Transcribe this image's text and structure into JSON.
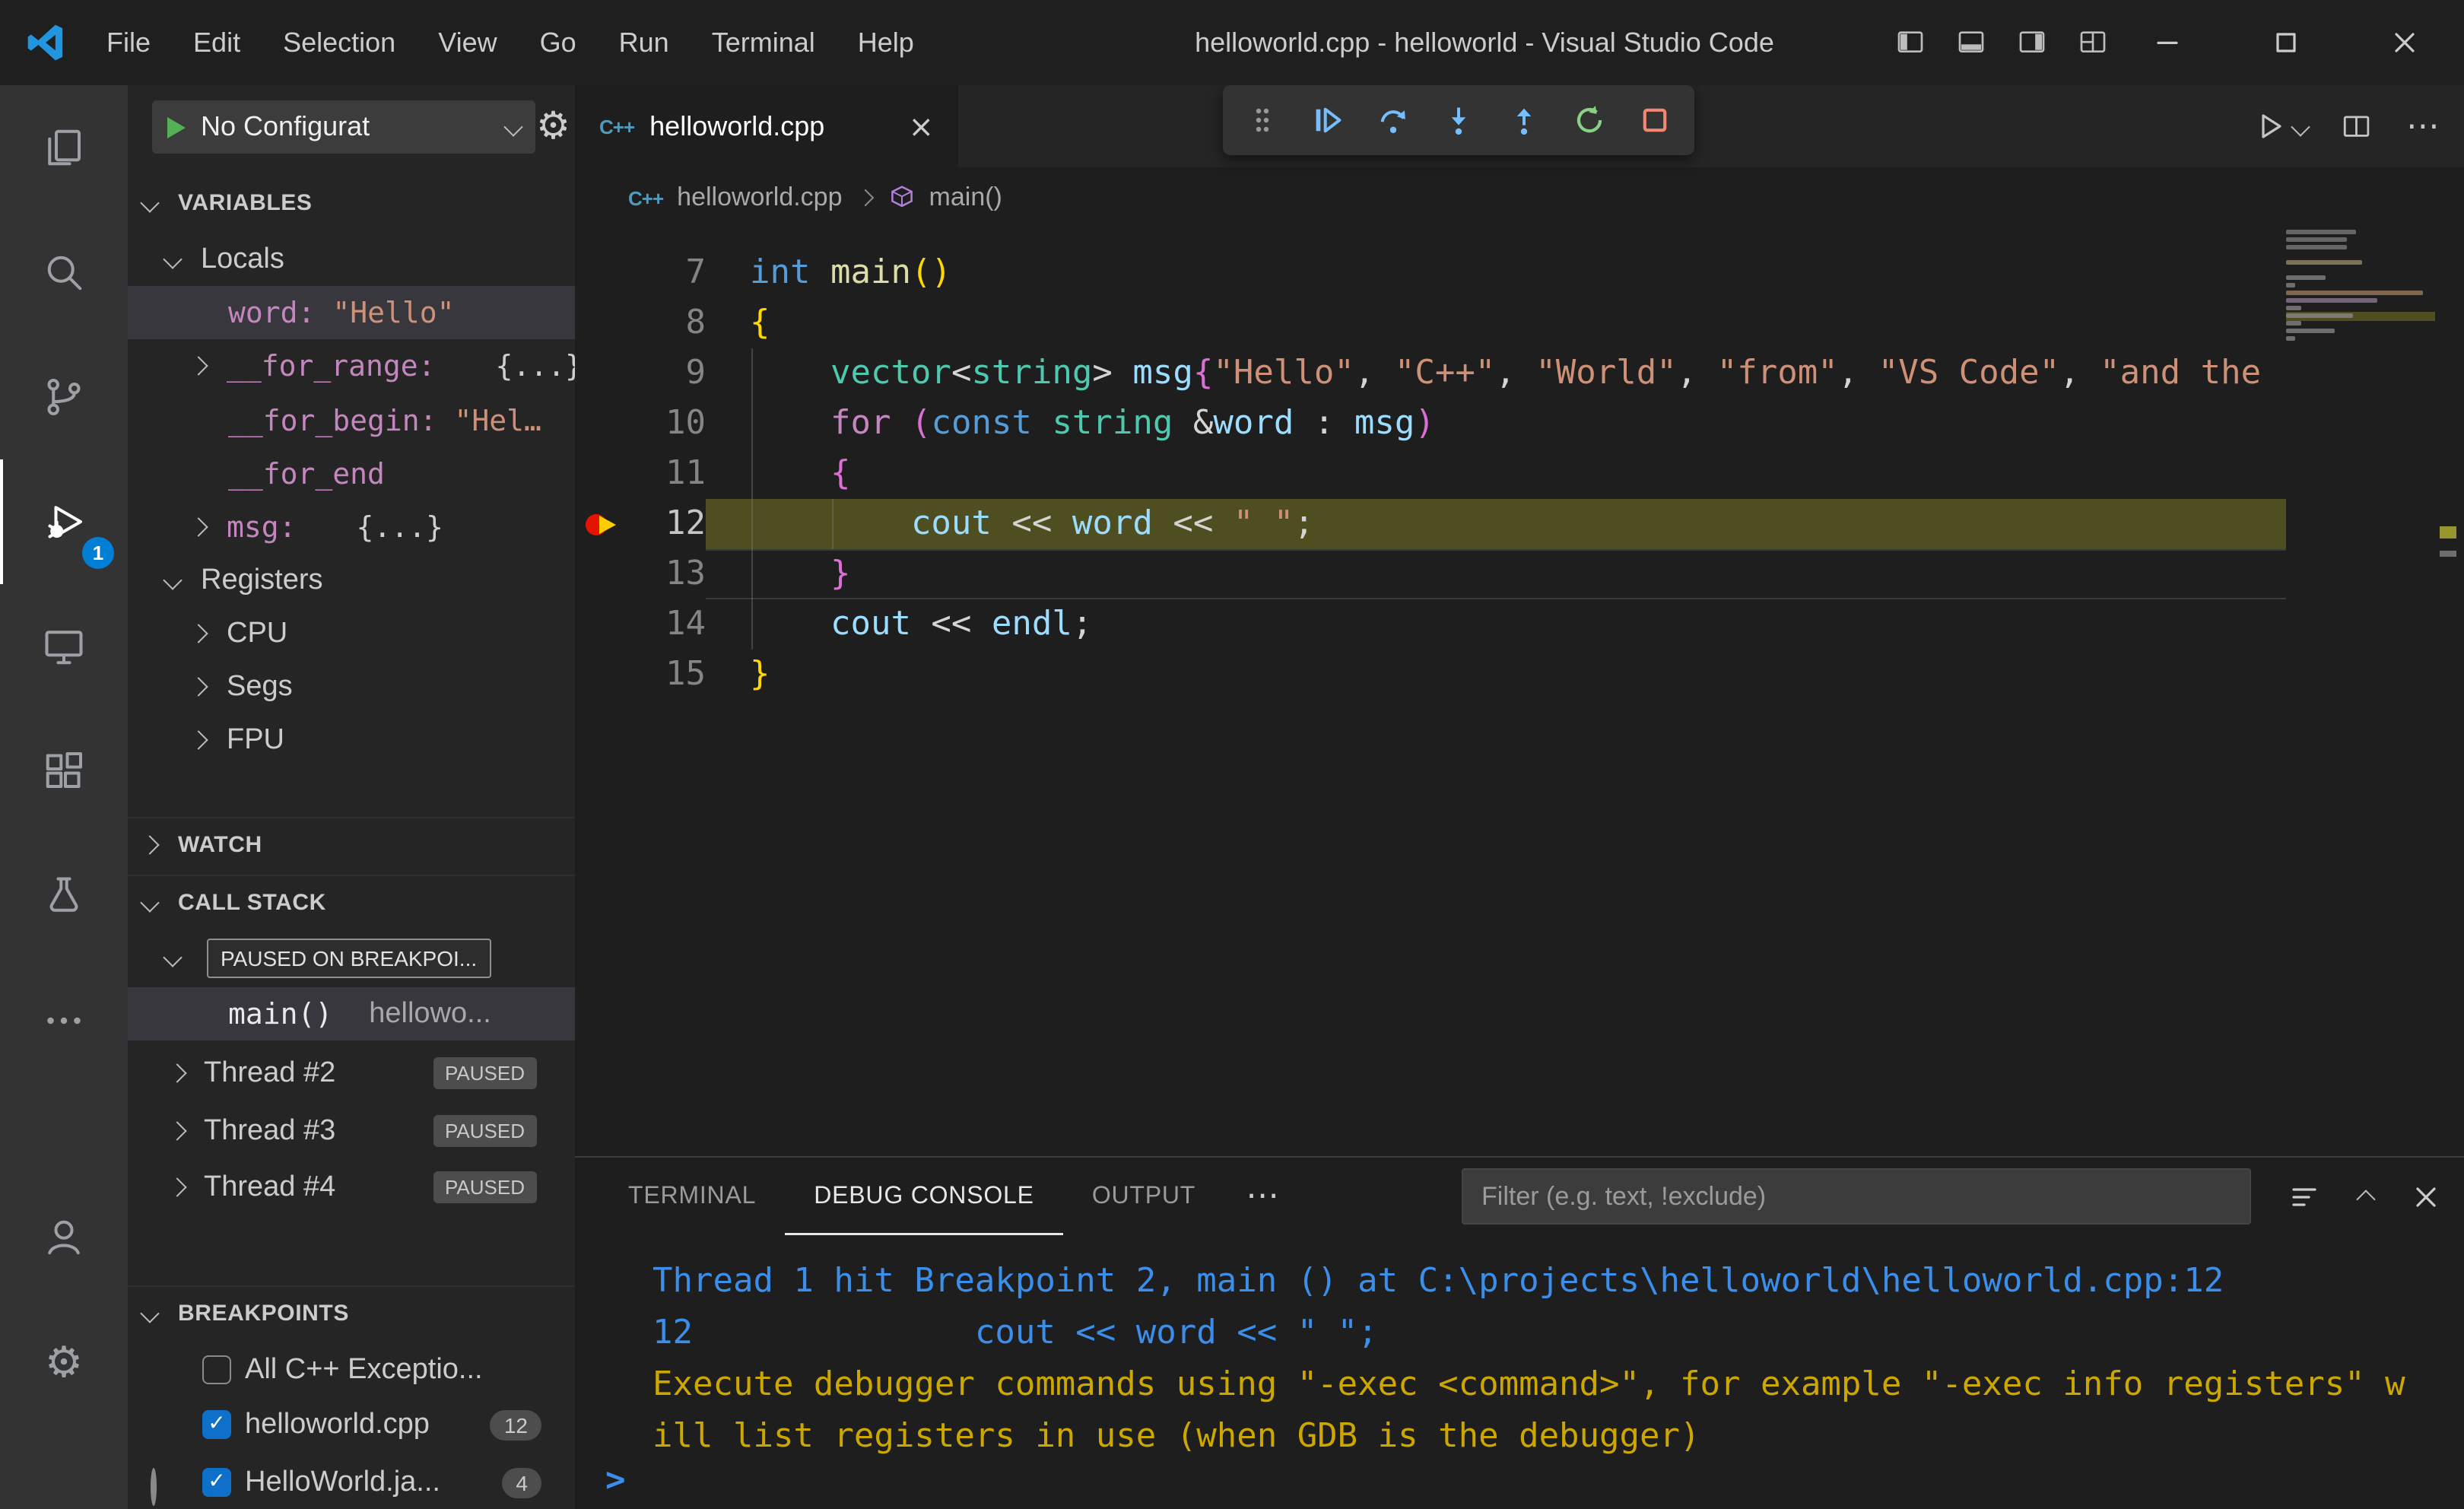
{
  "titlebar": {
    "menus": [
      "File",
      "Edit",
      "Selection",
      "View",
      "Go",
      "Run",
      "Terminal",
      "Help"
    ],
    "title": "helloworld.cpp - helloworld - Visual Studio Code"
  },
  "activity_bar": {
    "badge": "1",
    "items": [
      "explorer",
      "search",
      "source-control",
      "run-and-debug",
      "remote-explorer",
      "extensions",
      "testing",
      "more",
      "account",
      "settings"
    ],
    "active_item": "run-and-debug"
  },
  "sidebar": {
    "debug_config": {
      "label": "No Configurat"
    },
    "variables": {
      "header": "VARIABLES",
      "locals": "Locals",
      "items": [
        {
          "name": "word:",
          "value": "\"Hello\"",
          "kind": "string",
          "selected": true
        },
        {
          "name": "__for_range:",
          "value": "{...}",
          "kind": "object",
          "expandable": true
        },
        {
          "name": "__for_begin:",
          "value": "\"Hel…",
          "kind": "string"
        },
        {
          "name": "__for_end",
          "value": "",
          "kind": "none"
        },
        {
          "name": "msg:",
          "value": "{...}",
          "kind": "object",
          "expandable": true
        }
      ],
      "registers": "Registers",
      "register_groups": [
        "CPU",
        "Segs",
        "FPU"
      ]
    },
    "watch": {
      "header": "WATCH"
    },
    "call_stack": {
      "header": "CALL STACK",
      "status": "PAUSED ON BREAKPOI...",
      "frame": {
        "name": "main()",
        "file": "hellowo..."
      },
      "threads": [
        {
          "name": "Thread #2",
          "state": "PAUSED"
        },
        {
          "name": "Thread #3",
          "state": "PAUSED"
        },
        {
          "name": "Thread #4",
          "state": "PAUSED"
        }
      ]
    },
    "breakpoints": {
      "header": "BREAKPOINTS",
      "items": [
        {
          "label": "All C++ Exceptio...",
          "checked": false,
          "marker": "none",
          "count": ""
        },
        {
          "label": "helloworld.cpp",
          "checked": true,
          "marker": "breakpoint",
          "count": "12"
        },
        {
          "label": "HelloWorld.ja...",
          "checked": true,
          "marker": "breakpoint-disabled",
          "count": "4"
        }
      ]
    }
  },
  "editor": {
    "tab": "helloworld.cpp",
    "breadcrumb_file": "helloworld.cpp",
    "breadcrumb_symbol": "main()",
    "lines": [
      {
        "num": "7",
        "tokens": [
          [
            "int",
            "kw"
          ],
          [
            " ",
            "pl"
          ],
          [
            "main",
            "fn"
          ],
          [
            "()",
            "b1"
          ]
        ]
      },
      {
        "num": "8",
        "tokens": [
          [
            "{",
            "b1"
          ]
        ]
      },
      {
        "num": "9",
        "tokens": [
          [
            "    ",
            "pl"
          ],
          [
            "vector",
            "ty"
          ],
          [
            "<",
            "pl"
          ],
          [
            "string",
            "ty"
          ],
          [
            ">",
            "pl"
          ],
          [
            " ",
            "pl"
          ],
          [
            "msg",
            "va"
          ],
          [
            "{",
            "b2"
          ],
          [
            "\"Hello\"",
            "st"
          ],
          [
            ", ",
            "pl"
          ],
          [
            "\"C++\"",
            "st"
          ],
          [
            ", ",
            "pl"
          ],
          [
            "\"World\"",
            "st"
          ],
          [
            ", ",
            "pl"
          ],
          [
            "\"from\"",
            "st"
          ],
          [
            ", ",
            "pl"
          ],
          [
            "\"VS Code\"",
            "st"
          ],
          [
            ", ",
            "pl"
          ],
          [
            "\"and the",
            "st"
          ]
        ]
      },
      {
        "num": "10",
        "tokens": [
          [
            "    ",
            "pl"
          ],
          [
            "for",
            "cf"
          ],
          [
            " ",
            "pl"
          ],
          [
            "(",
            "b2"
          ],
          [
            "const",
            "kw"
          ],
          [
            " ",
            "pl"
          ],
          [
            "string",
            "ty"
          ],
          [
            " &",
            "pl"
          ],
          [
            "word",
            "va"
          ],
          [
            " : ",
            "pl"
          ],
          [
            "msg",
            "va"
          ],
          [
            ")",
            "b2"
          ]
        ]
      },
      {
        "num": "11",
        "tokens": [
          [
            "    ",
            "pl"
          ],
          [
            "{",
            "b2"
          ]
        ]
      },
      {
        "num": "12",
        "highlight": true,
        "breakpoint": true,
        "tokens": [
          [
            "        ",
            "pl"
          ],
          [
            "cout",
            "va"
          ],
          [
            " << ",
            "pl"
          ],
          [
            "word",
            "va"
          ],
          [
            " << ",
            "pl"
          ],
          [
            "\" \"",
            "st"
          ],
          [
            ";",
            "pl"
          ]
        ]
      },
      {
        "num": "13",
        "cursor": true,
        "tokens": [
          [
            "    ",
            "pl"
          ],
          [
            "}",
            "b2"
          ]
        ]
      },
      {
        "num": "14",
        "tokens": [
          [
            "    ",
            "pl"
          ],
          [
            "cout",
            "va"
          ],
          [
            " << ",
            "pl"
          ],
          [
            "endl",
            "va"
          ],
          [
            ";",
            "pl"
          ]
        ]
      },
      {
        "num": "15",
        "tokens": [
          [
            "}",
            "b1"
          ]
        ]
      }
    ]
  },
  "debug_toolbar": {
    "buttons": [
      "drag-handle",
      "continue",
      "step-over",
      "step-into",
      "step-out",
      "restart",
      "stop"
    ]
  },
  "panel": {
    "tabs": [
      "TERMINAL",
      "DEBUG CONSOLE",
      "OUTPUT"
    ],
    "active_tab": "DEBUG CONSOLE",
    "filter_placeholder": "Filter (e.g. text, !exclude)",
    "lines": [
      {
        "text": "Thread 1 hit Breakpoint 2, main () at C:\\projects\\helloworld\\helloworld.cpp:12",
        "color": "blue"
      },
      {
        "text": "12              cout << word << \" \";",
        "color": "blue"
      },
      {
        "text": "Execute debugger commands using \"-exec <command>\", for example \"-exec info registers\" w",
        "color": "yellow"
      },
      {
        "text": "ill list registers in use (when GDB is the debugger)",
        "color": "yellow"
      }
    ],
    "prompt": ">",
    "actions": [
      "console-options",
      "maximize-panel",
      "close-panel"
    ]
  },
  "colors": {
    "accent_badge_blue": "#007fd4",
    "breakpoint_red": "#e51400",
    "current_line_highlight": "#4e4e20",
    "console_info_blue": "#3b8eea",
    "console_warning_yellow": "#cca700",
    "debug_step_blue": "#75beff",
    "restart_green": "#89d185",
    "stop_red": "#f48771"
  }
}
